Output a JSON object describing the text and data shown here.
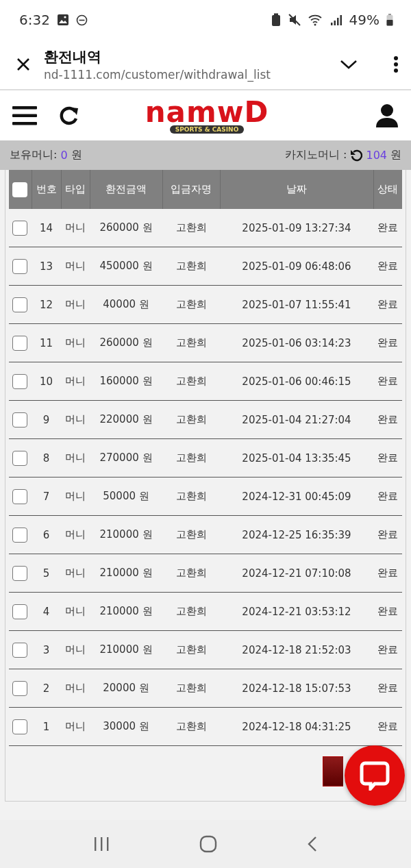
{
  "status_bar": {
    "time": "6:32",
    "battery": "49%"
  },
  "browser": {
    "title": "환전내역",
    "url": "nd-1111.com/customer/withdrawal_list"
  },
  "logo": {
    "name": "namwD",
    "tagline": "SPORTS & CASINO"
  },
  "balance": {
    "money_label": "보유머니:",
    "money_value": "0",
    "money_unit": "원",
    "casino_label": "카지노머니 :",
    "casino_value": "104",
    "casino_unit": "원"
  },
  "table": {
    "select_all": {
      "checked": false
    },
    "columns": [
      "번호",
      "타입",
      "환전금액",
      "입금자명",
      "날짜",
      "상태"
    ],
    "rows": [
      {
        "checked": false,
        "cells": [
          "14",
          "머니",
          "260000 원",
          "고환희",
          "2025-01-09 13:27:34",
          "완료"
        ]
      },
      {
        "checked": false,
        "cells": [
          "13",
          "머니",
          "450000 원",
          "고환희",
          "2025-01-09 06:48:06",
          "완료"
        ]
      },
      {
        "checked": false,
        "cells": [
          "12",
          "머니",
          "40000 원",
          "고환희",
          "2025-01-07 11:55:41",
          "완료"
        ]
      },
      {
        "checked": false,
        "cells": [
          "11",
          "머니",
          "260000 원",
          "고환희",
          "2025-01-06 03:14:23",
          "완료"
        ]
      },
      {
        "checked": false,
        "cells": [
          "10",
          "머니",
          "160000 원",
          "고환희",
          "2025-01-06 00:46:15",
          "완료"
        ]
      },
      {
        "checked": false,
        "cells": [
          "9",
          "머니",
          "220000 원",
          "고환희",
          "2025-01-04 21:27:04",
          "완료"
        ]
      },
      {
        "checked": false,
        "cells": [
          "8",
          "머니",
          "270000 원",
          "고환희",
          "2025-01-04 13:35:45",
          "완료"
        ]
      },
      {
        "checked": false,
        "cells": [
          "7",
          "머니",
          "50000 원",
          "고환희",
          "2024-12-31 00:45:09",
          "완료"
        ]
      },
      {
        "checked": false,
        "cells": [
          "6",
          "머니",
          "210000 원",
          "고환희",
          "2024-12-25 16:35:39",
          "완료"
        ]
      },
      {
        "checked": false,
        "cells": [
          "5",
          "머니",
          "210000 원",
          "고환희",
          "2024-12-21 07:10:08",
          "완료"
        ]
      },
      {
        "checked": false,
        "cells": [
          "4",
          "머니",
          "210000 원",
          "고환희",
          "2024-12-21 03:53:12",
          "완료"
        ]
      },
      {
        "checked": false,
        "cells": [
          "3",
          "머니",
          "210000 원",
          "고환희",
          "2024-12-18 21:52:03",
          "완료"
        ]
      },
      {
        "checked": false,
        "cells": [
          "2",
          "머니",
          "20000 원",
          "고환희",
          "2024-12-18 15:07:53",
          "완료"
        ]
      },
      {
        "checked": false,
        "cells": [
          "1",
          "머니",
          "30000 원",
          "고환희",
          "2024-12-18 04:31:25",
          "완료"
        ]
      }
    ]
  }
}
